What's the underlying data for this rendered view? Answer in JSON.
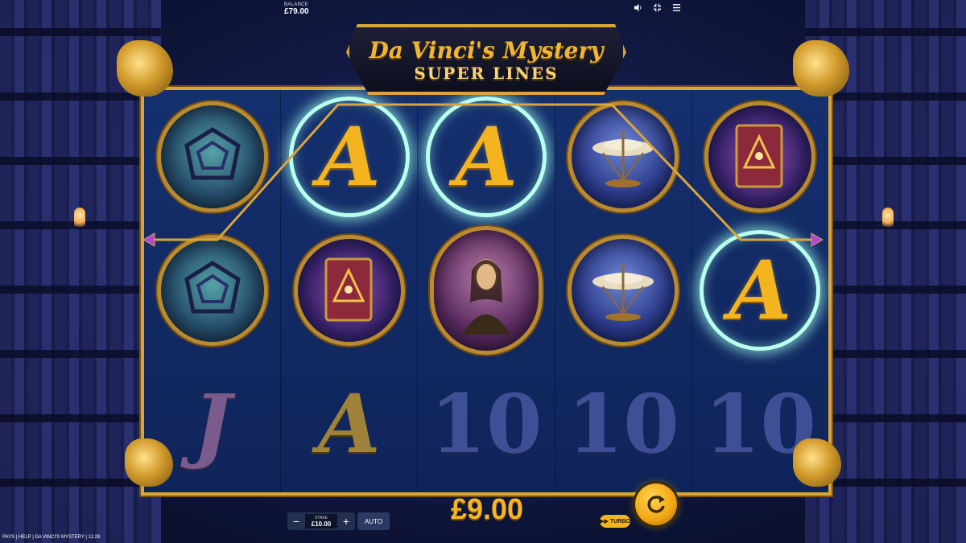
{
  "hud": {
    "balance_label": "BALANCE",
    "balance_value": "£79.00",
    "icons": [
      "speaker-icon",
      "collapse-icon",
      "menu-icon"
    ]
  },
  "title": {
    "main": "Da Vinci's Mystery",
    "sub": "SUPER LINES"
  },
  "reels": [
    [
      "gem",
      "gem",
      "J"
    ],
    [
      "A",
      "book",
      "A"
    ],
    [
      "A",
      "mona-lisa",
      "10"
    ],
    [
      "helicopter",
      "helicopter",
      "10"
    ],
    [
      "book",
      "A",
      "10"
    ]
  ],
  "winning_cells": [
    [
      1,
      0
    ],
    [
      2,
      0
    ],
    [
      4,
      1
    ]
  ],
  "controls": {
    "stake_label": "STAKE",
    "stake_value": "£10.00",
    "minus": "−",
    "plus": "+",
    "auto_label": "AUTO",
    "win_amount": "£9.00",
    "turbo_label": "TURBO"
  },
  "footer": {
    "text": "PAYS | HELP | DA VINCI'S MYSTERY | 11:28"
  },
  "colors": {
    "gold": "#f3b41f",
    "frame": "#d9a53a",
    "win_ring": "#b9ffee",
    "background": "#121a45"
  }
}
